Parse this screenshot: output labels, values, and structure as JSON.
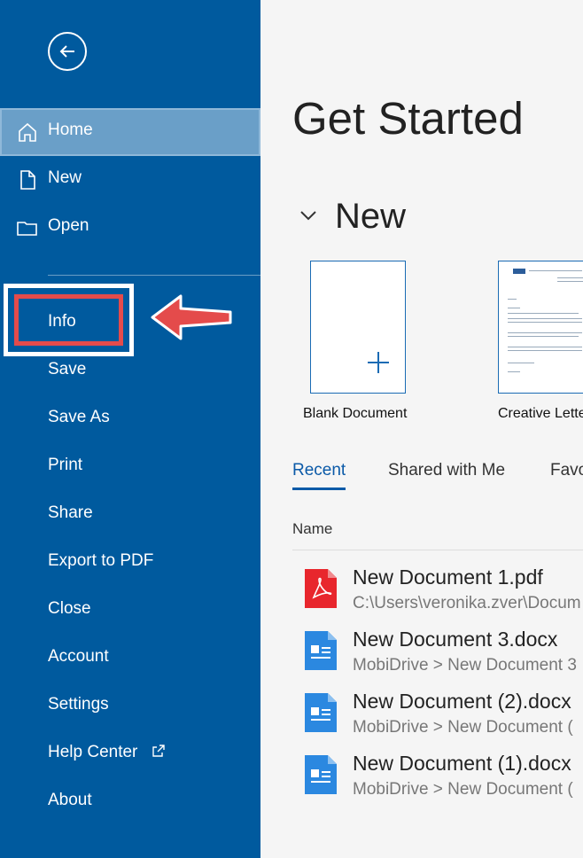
{
  "sidebar": {
    "items": [
      {
        "label": "Home"
      },
      {
        "label": "New"
      },
      {
        "label": "Open"
      },
      {
        "label": "Info"
      },
      {
        "label": "Save"
      },
      {
        "label": "Save As"
      },
      {
        "label": "Print"
      },
      {
        "label": "Share"
      },
      {
        "label": "Export to PDF"
      },
      {
        "label": "Close"
      },
      {
        "label": "Account"
      },
      {
        "label": "Settings"
      },
      {
        "label": "Help Center"
      },
      {
        "label": "About"
      }
    ]
  },
  "main": {
    "title": "Get Started",
    "new_section": "New",
    "templates": [
      {
        "label": "Blank Document"
      },
      {
        "label": "Creative Lette"
      }
    ],
    "tabs": [
      {
        "label": "Recent"
      },
      {
        "label": "Shared with Me"
      },
      {
        "label": "Favo"
      }
    ],
    "column_name": "Name",
    "files": [
      {
        "name": "New Document 1.pdf",
        "path": "C:\\Users\\veronika.zver\\Docum",
        "icon": "pdf-icon"
      },
      {
        "name": "New Document 3.docx",
        "path": "MobiDrive > New Document 3",
        "icon": "docx-icon"
      },
      {
        "name": "New Document (2).docx",
        "path": "MobiDrive > New Document (",
        "icon": "docx-icon"
      },
      {
        "name": "New Document (1).docx",
        "path": "MobiDrive > New Document (",
        "icon": "docx-icon"
      }
    ]
  },
  "colors": {
    "sidebar": "#005a9e",
    "accent": "#0b5aa8",
    "highlight": "#e44b4b"
  }
}
